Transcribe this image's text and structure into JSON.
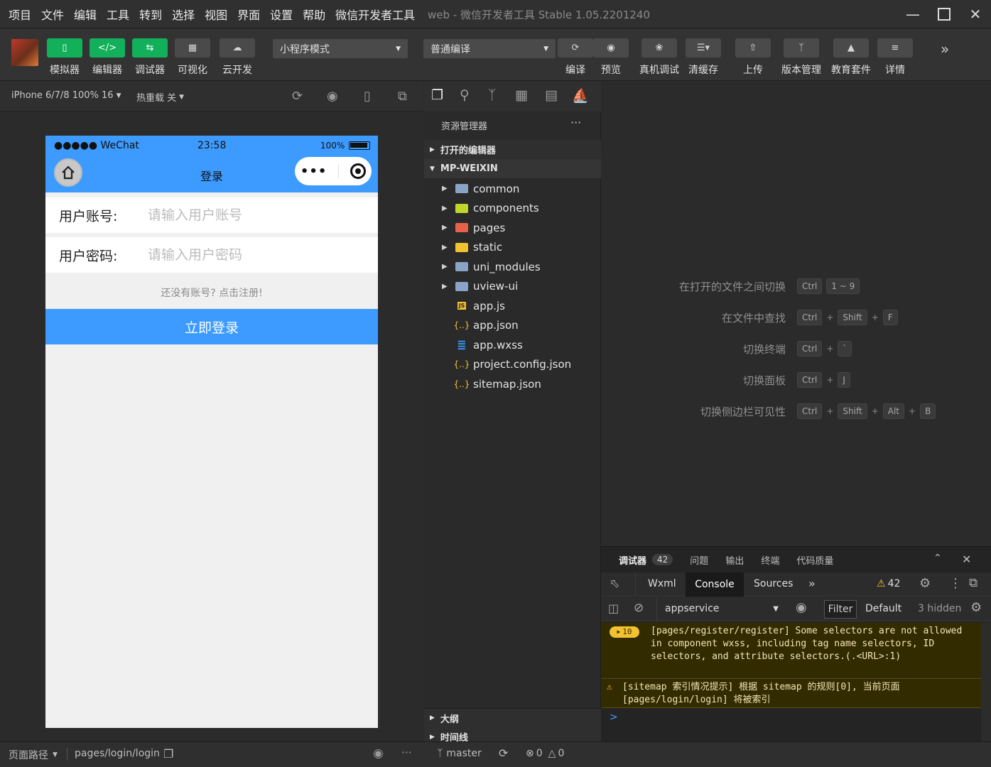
{
  "titlebar": {
    "menu": [
      "项目",
      "文件",
      "编辑",
      "工具",
      "转到",
      "选择",
      "视图",
      "界面",
      "设置",
      "帮助",
      "微信开发者工具"
    ],
    "app_title": "web - 微信开发者工具 Stable 1.05.2201240"
  },
  "toolbar": {
    "simulator": "模拟器",
    "editor": "编辑器",
    "debugger": "调试器",
    "visual": "可视化",
    "cloud": "云开发",
    "mode": "小程序模式",
    "compile_mode": "普通编译",
    "compile": "编译",
    "preview": "预览",
    "real_debug": "真机调试",
    "clear_cache": "清缓存",
    "upload": "上传",
    "version": "版本管理",
    "edu": "教育套件",
    "details": "详情"
  },
  "simbar": {
    "device": "iPhone 6/7/8 100% 16",
    "hotreload": "热重载 关"
  },
  "phone": {
    "carrier": "●●●●● WeChat",
    "time": "23:58",
    "battery": "100%",
    "page_title": "登录",
    "account_label": "用户账号:",
    "account_placeholder": "请输入用户账号",
    "password_label": "用户密码:",
    "password_placeholder": "请输入用户密码",
    "register_link": "还没有账号? 点击注册!",
    "login_button": "立即登录"
  },
  "explorer": {
    "title": "资源管理器",
    "more": "···",
    "open_editors": "打开的编辑器",
    "project": "MP-WEIXIN",
    "items": [
      {
        "name": "common",
        "type": "folder",
        "color": "#8aa4c8"
      },
      {
        "name": "components",
        "type": "folder",
        "color": "#c0d62a"
      },
      {
        "name": "pages",
        "type": "folder",
        "color": "#e8624a"
      },
      {
        "name": "static",
        "type": "folder",
        "color": "#f2c230"
      },
      {
        "name": "uni_modules",
        "type": "folder",
        "color": "#8aa4c8"
      },
      {
        "name": "uview-ui",
        "type": "folder",
        "color": "#8aa4c8"
      },
      {
        "name": "app.js",
        "type": "js"
      },
      {
        "name": "app.json",
        "type": "json"
      },
      {
        "name": "app.wxss",
        "type": "css"
      },
      {
        "name": "project.config.json",
        "type": "json"
      },
      {
        "name": "sitemap.json",
        "type": "json"
      }
    ],
    "outline": "大纲",
    "timeline": "时间线"
  },
  "shortcuts": [
    {
      "label": "在打开的文件之间切换",
      "keys": [
        "Ctrl",
        "1 ~ 9"
      ],
      "plus": false
    },
    {
      "label": "在文件中查找",
      "keys": [
        "Ctrl",
        "Shift",
        "F"
      ],
      "plus": true
    },
    {
      "label": "切换终端",
      "keys": [
        "Ctrl",
        "`"
      ],
      "plus": true
    },
    {
      "label": "切换面板",
      "keys": [
        "Ctrl",
        "J"
      ],
      "plus": true
    },
    {
      "label": "切换侧边栏可见性",
      "keys": [
        "Ctrl",
        "Shift",
        "Alt",
        "B"
      ],
      "plus": true
    }
  ],
  "debug": {
    "tabs": [
      "调试器",
      "问题",
      "输出",
      "终端",
      "代码质量"
    ],
    "badge": "42",
    "devtabs": [
      "Wxml",
      "Console",
      "Sources"
    ],
    "warn_count": "42",
    "context": "appservice",
    "filter": "Filter",
    "level": "Default",
    "hidden": "3 hidden",
    "msg1_count": "10",
    "msg1": "[pages/register/register] Some selectors are not allowed in component wxss, including tag name selectors, ID selectors, and attribute selectors.(.<URL>:1)",
    "msg2": "[sitemap 索引情况提示] 根据 sitemap 的规则[0], 当前页面 [pages/login/login] 将被索引",
    "prompt": ">"
  },
  "bottom": {
    "page_path_label": "页面路径",
    "page_path": "pages/login/login",
    "branch": "master",
    "errors": "0",
    "warnings": "0"
  }
}
